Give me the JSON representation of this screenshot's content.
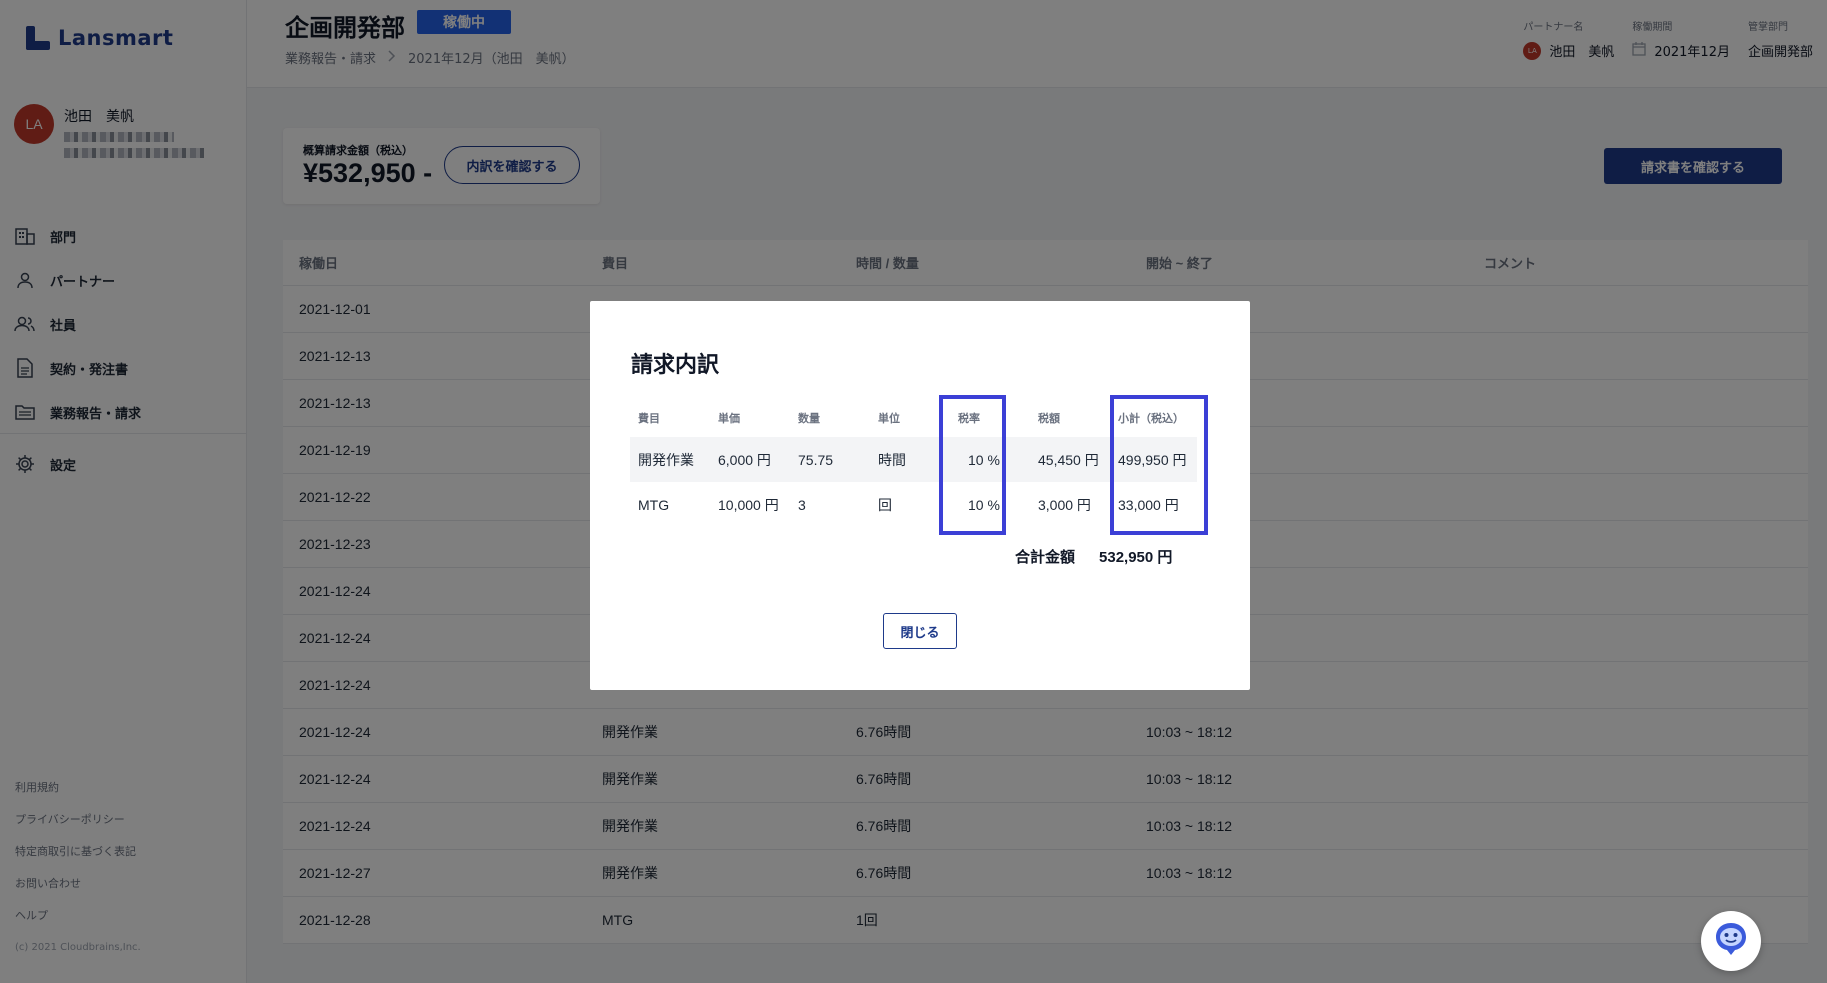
{
  "app": {
    "logo_text": "Lansmart"
  },
  "user": {
    "initials": "LA",
    "name": "池田　美帆"
  },
  "sidebar": {
    "items": [
      {
        "label": "部門",
        "icon": "building-icon"
      },
      {
        "label": "パートナー",
        "icon": "person-icon"
      },
      {
        "label": "社員",
        "icon": "people-icon"
      },
      {
        "label": "契約・発注書",
        "icon": "document-icon"
      },
      {
        "label": "業務報告・請求",
        "icon": "folder-icon"
      }
    ],
    "settings_label": "設定"
  },
  "footer": {
    "links": [
      "利用規約",
      "プライバシーポリシー",
      "特定商取引に基づく表記",
      "お問い合わせ",
      "ヘルプ"
    ],
    "copyright": "(c) 2021 Cloudbrains,Inc."
  },
  "header": {
    "title": "企画開発部",
    "status": "稼働中",
    "breadcrumb": [
      "業務報告・請求",
      "2021年12月（池田　美帆）"
    ],
    "meta": {
      "partner_label": "パートナー名",
      "partner_initials": "LA",
      "partner_value": "池田　美帆",
      "period_label": "稼働期間",
      "period_value": "2021年12月",
      "dept_label": "管掌部門",
      "dept_value": "企画開発部"
    }
  },
  "summary": {
    "label": "概算請求金額（税込）",
    "amount": "¥532,950 -",
    "breakdown_button": "内訳を確認する",
    "invoice_button": "請求書を確認する"
  },
  "table": {
    "headers": [
      "稼働日",
      "費目",
      "時間 / 数量",
      "開始 ~ 終了",
      "コメント"
    ],
    "rows": [
      [
        "2021-12-01",
        "",
        "",
        "",
        ""
      ],
      [
        "2021-12-13",
        "",
        "",
        "",
        ""
      ],
      [
        "2021-12-13",
        "",
        "",
        "",
        ""
      ],
      [
        "2021-12-19",
        "",
        "",
        "",
        ""
      ],
      [
        "2021-12-22",
        "",
        "",
        "",
        ""
      ],
      [
        "2021-12-23",
        "",
        "",
        "",
        ""
      ],
      [
        "2021-12-24",
        "",
        "",
        "",
        ""
      ],
      [
        "2021-12-24",
        "",
        "",
        "",
        ""
      ],
      [
        "2021-12-24",
        "",
        "",
        "",
        ""
      ],
      [
        "2021-12-24",
        "開発作業",
        "6.76時間",
        "10:03 ~ 18:12",
        ""
      ],
      [
        "2021-12-24",
        "開発作業",
        "6.76時間",
        "10:03 ~ 18:12",
        ""
      ],
      [
        "2021-12-24",
        "開発作業",
        "6.76時間",
        "10:03 ~ 18:12",
        ""
      ],
      [
        "2021-12-27",
        "開発作業",
        "6.76時間",
        "10:03 ~ 18:12",
        ""
      ],
      [
        "2021-12-28",
        "MTG",
        "1回",
        "",
        ""
      ]
    ]
  },
  "modal": {
    "title": "請求内訳",
    "headers": [
      "費目",
      "単価",
      "数量",
      "単位",
      "税率",
      "税額",
      "小計（税込）"
    ],
    "rows": [
      [
        "開発作業",
        "6,000 円",
        "75.75",
        "時間",
        "10 %",
        "45,450 円",
        "499,950 円"
      ],
      [
        "MTG",
        "10,000 円",
        "3",
        "回",
        "10 %",
        "3,000 円",
        "33,000 円"
      ]
    ],
    "total_label": "合計金額",
    "total_value": "532,950 円",
    "close_button": "閉じる"
  },
  "colors": {
    "brand": "#1e3a8a",
    "status_badge": "#2563eb",
    "highlight": "#3b3fd6",
    "avatar": "#c0392b"
  }
}
